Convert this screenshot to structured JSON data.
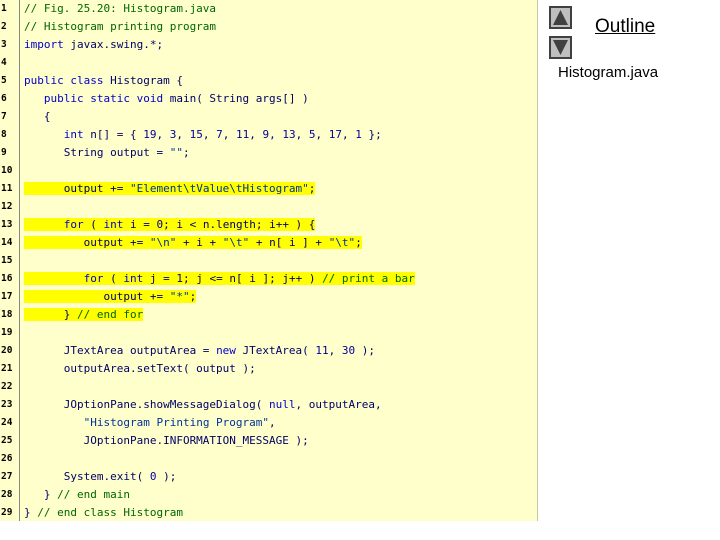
{
  "nav": {
    "outline_label": "Outline",
    "file_label": "Histogram.java",
    "up_icon": "triangle-up-icon",
    "down_icon": "triangle-down-icon"
  },
  "code": {
    "highlight_color": "#ffff00",
    "background_color": "#ffffcc",
    "lines": [
      {
        "n": "1",
        "tokens": [
          {
            "t": "// Fig. 25.20: Histogram.java",
            "c": "comment"
          }
        ]
      },
      {
        "n": "2",
        "tokens": [
          {
            "t": "// Histogram printing program",
            "c": "comment"
          }
        ]
      },
      {
        "n": "3",
        "tokens": [
          {
            "t": "import",
            "c": "keyword"
          },
          {
            "t": " javax.swing.*;",
            "c": "plain"
          }
        ]
      },
      {
        "n": "4",
        "tokens": []
      },
      {
        "n": "5",
        "tokens": [
          {
            "t": "public class",
            "c": "keyword"
          },
          {
            "t": " Histogram {",
            "c": "plain"
          }
        ]
      },
      {
        "n": "6",
        "tokens": [
          {
            "t": "   public static void",
            "c": "keyword"
          },
          {
            "t": " main( String args[] )",
            "c": "plain"
          }
        ]
      },
      {
        "n": "7",
        "tokens": [
          {
            "t": "   {",
            "c": "plain"
          }
        ]
      },
      {
        "n": "8",
        "tokens": [
          {
            "t": "      int",
            "c": "keyword"
          },
          {
            "t": " n[] = { ",
            "c": "plain"
          },
          {
            "t": "19",
            "c": "number"
          },
          {
            "t": ", ",
            "c": "plain"
          },
          {
            "t": "3",
            "c": "number"
          },
          {
            "t": ", ",
            "c": "plain"
          },
          {
            "t": "15",
            "c": "number"
          },
          {
            "t": ", ",
            "c": "plain"
          },
          {
            "t": "7",
            "c": "number"
          },
          {
            "t": ", ",
            "c": "plain"
          },
          {
            "t": "11",
            "c": "number"
          },
          {
            "t": ", ",
            "c": "plain"
          },
          {
            "t": "9",
            "c": "number"
          },
          {
            "t": ", ",
            "c": "plain"
          },
          {
            "t": "13",
            "c": "number"
          },
          {
            "t": ", ",
            "c": "plain"
          },
          {
            "t": "5",
            "c": "number"
          },
          {
            "t": ", ",
            "c": "plain"
          },
          {
            "t": "17",
            "c": "number"
          },
          {
            "t": ", ",
            "c": "plain"
          },
          {
            "t": "1",
            "c": "number"
          },
          {
            "t": " };",
            "c": "plain"
          }
        ]
      },
      {
        "n": "9",
        "tokens": [
          {
            "t": "      String output = ",
            "c": "plain"
          },
          {
            "t": "\"\"",
            "c": "string"
          },
          {
            "t": ";",
            "c": "plain"
          }
        ]
      },
      {
        "n": "10",
        "tokens": []
      },
      {
        "n": "11",
        "hl": true,
        "tokens": [
          {
            "t": "      output += ",
            "c": "plain"
          },
          {
            "t": "\"Element\\tValue\\tHistogram\"",
            "c": "string"
          },
          {
            "t": ";",
            "c": "plain"
          }
        ]
      },
      {
        "n": "12",
        "tokens": []
      },
      {
        "n": "13",
        "hl": true,
        "tokens": [
          {
            "t": "      for",
            "c": "keyword"
          },
          {
            "t": " ( ",
            "c": "plain"
          },
          {
            "t": "int",
            "c": "keyword"
          },
          {
            "t": " i = ",
            "c": "plain"
          },
          {
            "t": "0",
            "c": "number"
          },
          {
            "t": "; i < n.length; i++ ) {",
            "c": "plain"
          }
        ]
      },
      {
        "n": "14",
        "hl": true,
        "tokens": [
          {
            "t": "         output += ",
            "c": "plain"
          },
          {
            "t": "\"\\n\"",
            "c": "string"
          },
          {
            "t": " + i + ",
            "c": "plain"
          },
          {
            "t": "\"\\t\"",
            "c": "string"
          },
          {
            "t": " + n[ i ] + ",
            "c": "plain"
          },
          {
            "t": "\"\\t\"",
            "c": "string"
          },
          {
            "t": ";",
            "c": "plain"
          }
        ]
      },
      {
        "n": "15",
        "tokens": []
      },
      {
        "n": "16",
        "hl": true,
        "tokens": [
          {
            "t": "         for",
            "c": "keyword"
          },
          {
            "t": " ( ",
            "c": "plain"
          },
          {
            "t": "int",
            "c": "keyword"
          },
          {
            "t": " j = ",
            "c": "plain"
          },
          {
            "t": "1",
            "c": "number"
          },
          {
            "t": "; j <= n[ i ]; j++ ) ",
            "c": "plain"
          },
          {
            "t": "// print a bar",
            "c": "comment"
          }
        ]
      },
      {
        "n": "17",
        "hl": true,
        "tokens": [
          {
            "t": "            output += ",
            "c": "plain"
          },
          {
            "t": "\"*\"",
            "c": "string"
          },
          {
            "t": ";",
            "c": "plain"
          }
        ]
      },
      {
        "n": "18",
        "hl": true,
        "tokens": [
          {
            "t": "      } ",
            "c": "plain"
          },
          {
            "t": "// end for",
            "c": "comment"
          }
        ]
      },
      {
        "n": "19",
        "tokens": []
      },
      {
        "n": "20",
        "tokens": [
          {
            "t": "      JTextArea outputArea = ",
            "c": "plain"
          },
          {
            "t": "new",
            "c": "keyword"
          },
          {
            "t": " JTextArea( ",
            "c": "plain"
          },
          {
            "t": "11",
            "c": "number"
          },
          {
            "t": ", ",
            "c": "plain"
          },
          {
            "t": "30",
            "c": "number"
          },
          {
            "t": " );",
            "c": "plain"
          }
        ]
      },
      {
        "n": "21",
        "tokens": [
          {
            "t": "      outputArea.setText( output );",
            "c": "plain"
          }
        ]
      },
      {
        "n": "22",
        "tokens": []
      },
      {
        "n": "23",
        "tokens": [
          {
            "t": "      JOptionPane.showMessageDialog( ",
            "c": "plain"
          },
          {
            "t": "null",
            "c": "keyword"
          },
          {
            "t": ", outputArea,",
            "c": "plain"
          }
        ]
      },
      {
        "n": "24",
        "tokens": [
          {
            "t": "         ",
            "c": "plain"
          },
          {
            "t": "\"Histogram Printing Program\"",
            "c": "string"
          },
          {
            "t": ",",
            "c": "plain"
          }
        ]
      },
      {
        "n": "25",
        "tokens": [
          {
            "t": "         JOptionPane.INFORMATION_MESSAGE );",
            "c": "plain"
          }
        ]
      },
      {
        "n": "26",
        "tokens": []
      },
      {
        "n": "27",
        "tokens": [
          {
            "t": "      System.exit( ",
            "c": "plain"
          },
          {
            "t": "0",
            "c": "number"
          },
          {
            "t": " );",
            "c": "plain"
          }
        ]
      },
      {
        "n": "28",
        "tokens": [
          {
            "t": "   } ",
            "c": "plain"
          },
          {
            "t": "// end main",
            "c": "comment"
          }
        ]
      },
      {
        "n": "29",
        "tokens": [
          {
            "t": "} ",
            "c": "plain"
          },
          {
            "t": "// end class Histogram",
            "c": "comment"
          }
        ]
      }
    ]
  }
}
